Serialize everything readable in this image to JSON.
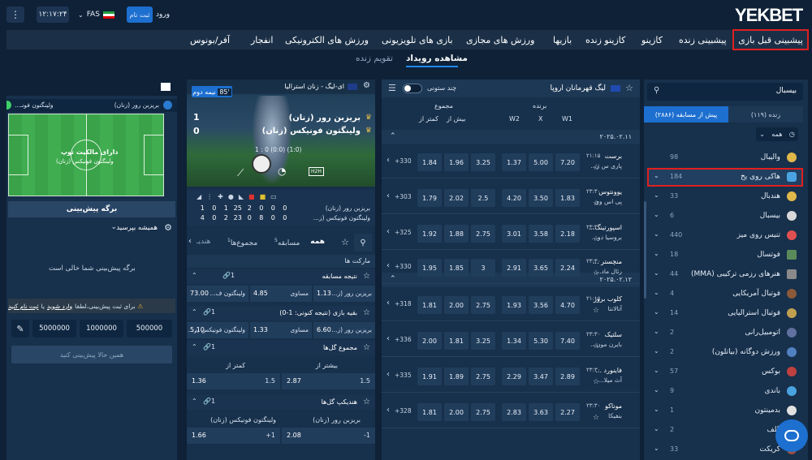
{
  "topbar": {
    "logo": "YEKBET",
    "login_label": "ورود",
    "register_label": "ثبت نام",
    "language": "FAS",
    "clock": "۱۲:۱۷:۲۴",
    "menu_icon": "vertical-dots-icon"
  },
  "nav": [
    {
      "label": "پیشبینی قبل بازی",
      "active": true
    },
    {
      "label": "پیشبینی زنده"
    },
    {
      "label": "کازینو"
    },
    {
      "label": "کازینو زنده"
    },
    {
      "label": "بازیها"
    },
    {
      "label": "ورزش های مجازی"
    },
    {
      "label": "بازی های تلویزیونی"
    },
    {
      "label": "ورزش های الکترونیکی"
    },
    {
      "label": "انفجار"
    },
    {
      "label": "آفر/بونوس"
    }
  ],
  "subnav": {
    "events": "مشاهده رویداد",
    "calendar": "تقویم زنده"
  },
  "sports_panel": {
    "search_value": "بیسبال",
    "tab_live": "زنده (۱۱۹)",
    "tab_prematch": "پیش از مسابقه (۲۸۸۶)",
    "filter_label": "همه",
    "items": [
      {
        "name": "والیبال",
        "count": "98",
        "color": "#e0b84a"
      },
      {
        "name": "هاکی روی یخ",
        "count": "184",
        "color": "#4aa3e0",
        "highlight": true
      },
      {
        "name": "هندبال",
        "count": "33",
        "color": "#e0b84a"
      },
      {
        "name": "بیسبال",
        "count": "6",
        "color": "#d8d8d8"
      },
      {
        "name": "تنیس روی میز",
        "count": "440",
        "color": "#e05050"
      },
      {
        "name": "فوتسال",
        "count": "18",
        "color": "#5a8a5a"
      },
      {
        "name": "هنرهای رزمی ترکیبی (MMA)",
        "count": "44",
        "color": "#8a8a8a"
      },
      {
        "name": "فوتبال آمریکایی",
        "count": "4",
        "color": "#8a5a3a"
      },
      {
        "name": "فوتبال استرالیایی",
        "count": "14",
        "color": "#c0a050"
      },
      {
        "name": "اتومبیل‌رانی",
        "count": "2",
        "color": "#6070a0"
      },
      {
        "name": "ورزش دوگانه (بیاتلون)",
        "count": "2",
        "color": "#5080c0"
      },
      {
        "name": "بوکس",
        "count": "57",
        "color": "#c04040"
      },
      {
        "name": "باندی",
        "count": "9",
        "color": "#4aa3e0"
      },
      {
        "name": "بدمینتون",
        "count": "1",
        "color": "#e0e0e0"
      },
      {
        "name": "گلف",
        "count": "2",
        "color": "#50a050"
      },
      {
        "name": "کریکت",
        "count": "33",
        "color": "#a05040"
      }
    ]
  },
  "events_panel": {
    "league": "لیگ قهرمانان اروپا",
    "multi_column": "چند ستونی",
    "headers": {
      "winner": "برنده",
      "total": "مجموع",
      "w1": "W1",
      "x": "X",
      "w2": "W2",
      "over": "بیش از",
      "under": "کمتر از"
    },
    "date1": "۲۰۲۵.۰۲.۱۱",
    "date2": "۲۰۲۵.۰۲.۱۲",
    "matches": [
      {
        "team1": "برست",
        "team2": "پاری س ژ...",
        "time": "۲۱:۱۵",
        "w1": "7.20",
        "x": "5.00",
        "w2": "1.37",
        "total": "3.25",
        "over": "1.96",
        "under": "1.84",
        "more": "+330"
      },
      {
        "team1": "یوونتوس",
        "team2": "پی اس وی",
        "time": "۲۳:۳۰",
        "w1": "1.83",
        "x": "3.50",
        "w2": "4.20",
        "total": "2.5",
        "over": "2.02",
        "under": "1.79",
        "more": "+303"
      },
      {
        "team1": "اسپورتینگ...",
        "team2": "بروسیا دو...",
        "time": "۲۳:۳۰",
        "w1": "2.18",
        "x": "3.58",
        "w2": "3.01",
        "total": "2.75",
        "over": "1.88",
        "under": "1.92",
        "more": "+325"
      },
      {
        "team1": "منچستر ...",
        "team2": "رئال ماد...",
        "time": "۲۳:۳۰",
        "w1": "2.24",
        "x": "3.65",
        "w2": "2.91",
        "total": "3",
        "over": "1.85",
        "under": "1.95",
        "more": "+330"
      },
      {
        "team1": "کلوب بروژ",
        "team2": "آتالانتا",
        "time": "۲۱:۱۵",
        "w1": "4.70",
        "x": "3.56",
        "w2": "1.93",
        "total": "2.75",
        "over": "2.00",
        "under": "1.81",
        "more": "+318"
      },
      {
        "team1": "سلتیک",
        "team2": "بایرن مون...",
        "time": "۲۳:۳۰",
        "w1": "7.40",
        "x": "5.30",
        "w2": "1.34",
        "total": "3.25",
        "over": "1.81",
        "under": "2.00",
        "more": "+336"
      },
      {
        "team1": "فاینورد ...",
        "team2": "آث میلا...",
        "time": "۲۳:۳۰",
        "w1": "2.89",
        "x": "3.47",
        "w2": "2.29",
        "total": "2.75",
        "over": "1.89",
        "under": "1.91",
        "more": "+335"
      },
      {
        "team1": "موناکو",
        "team2": "بنفیکا",
        "time": "۲۳:۳۰",
        "w1": "2.27",
        "x": "3.63",
        "w2": "2.83",
        "total": "2.75",
        "over": "2.00",
        "under": "1.81",
        "more": "+328"
      }
    ]
  },
  "live_panel": {
    "league": "ای-لیگ - زنان استرالیا",
    "time_label": "نیمه دوم",
    "minute": "85'",
    "team1": "بریزبن رور (زنان)",
    "team2": "ولینگتون فونیکس (زنان)",
    "score1": "1",
    "score2": "0",
    "detail": "1 : 0 (0:0) (1:0)",
    "h2h": "H2H",
    "stats_team1": "بریزبن رور (زنان)",
    "stats_team2": "ولینگتون فونیکس (ز...",
    "stats1": [
      "1",
      "0",
      "1",
      "25",
      "2",
      "0",
      "0",
      "0"
    ],
    "stats2": [
      "4",
      "0",
      "2",
      "23",
      "0",
      "8",
      "0",
      "0"
    ],
    "tabs": {
      "all": "همه",
      "match": "مسابقه",
      "match_sup": "5",
      "totals": "مجموع‌ها",
      "totals_sup": "1",
      "handicap": "هندیـ"
    },
    "markets_label": "مارکت ها",
    "market1": {
      "title": "نتیجه مسابقه",
      "link_count": "1",
      "home": "بریزبن رور (ز...",
      "home_odd": "1.13",
      "draw": "مساوی",
      "draw_odd": "4.85",
      "away": "ولینگتون ف...",
      "away_odd": "73.00"
    },
    "market2": {
      "title": "بقیه بازی (نتیجه کنونی: 1-0)",
      "link_count": "1",
      "home": "بریزبن رور (ز...",
      "home_odd": "6.60",
      "draw": "مساوی",
      "draw_odd": "1.33",
      "away": "ولینگتون فونیکس (ز...",
      "away_odd": "5.10"
    },
    "market3": {
      "title": "مجموع گل‌ها",
      "link_count": "1",
      "over": "بیشتر از",
      "under": "کمتر از",
      "over_line": "1.5",
      "over_odd": "2.87",
      "under_line": "1.5",
      "under_odd": "1.36"
    },
    "market4": {
      "title": "هندیکپ گل‌ها",
      "link_count": "1",
      "home": "بریزبن رور (زنان)",
      "away": "ولینگتون فونیکس (زنان)",
      "home_line": "-1",
      "home_odd": "2.08",
      "away_line": "+1",
      "away_odd": "1.66"
    }
  },
  "betslip": {
    "pitch_team": "بریزبن رور (زنان)",
    "pitch_team2": "ولینگتون فونـ...",
    "possession": "دارای مالکیت توپ",
    "possession_team": "ولینگتون فونیکس (زنان)",
    "title": "برگه پیش‌بینی",
    "ask_label": "همیشه بپرسید",
    "empty_text": "برگه پیش‌بینی شما خالی است",
    "warning_prefix": "برای ثبت پیش‌بینی،لطفا",
    "login_link": "وارد شوید",
    "or": "یا",
    "register_link": "ثبت نام کنید",
    "amounts": [
      "500000",
      "1000000",
      "5000000"
    ],
    "place_button": "همین حالا پیش‌بینی کنید"
  }
}
